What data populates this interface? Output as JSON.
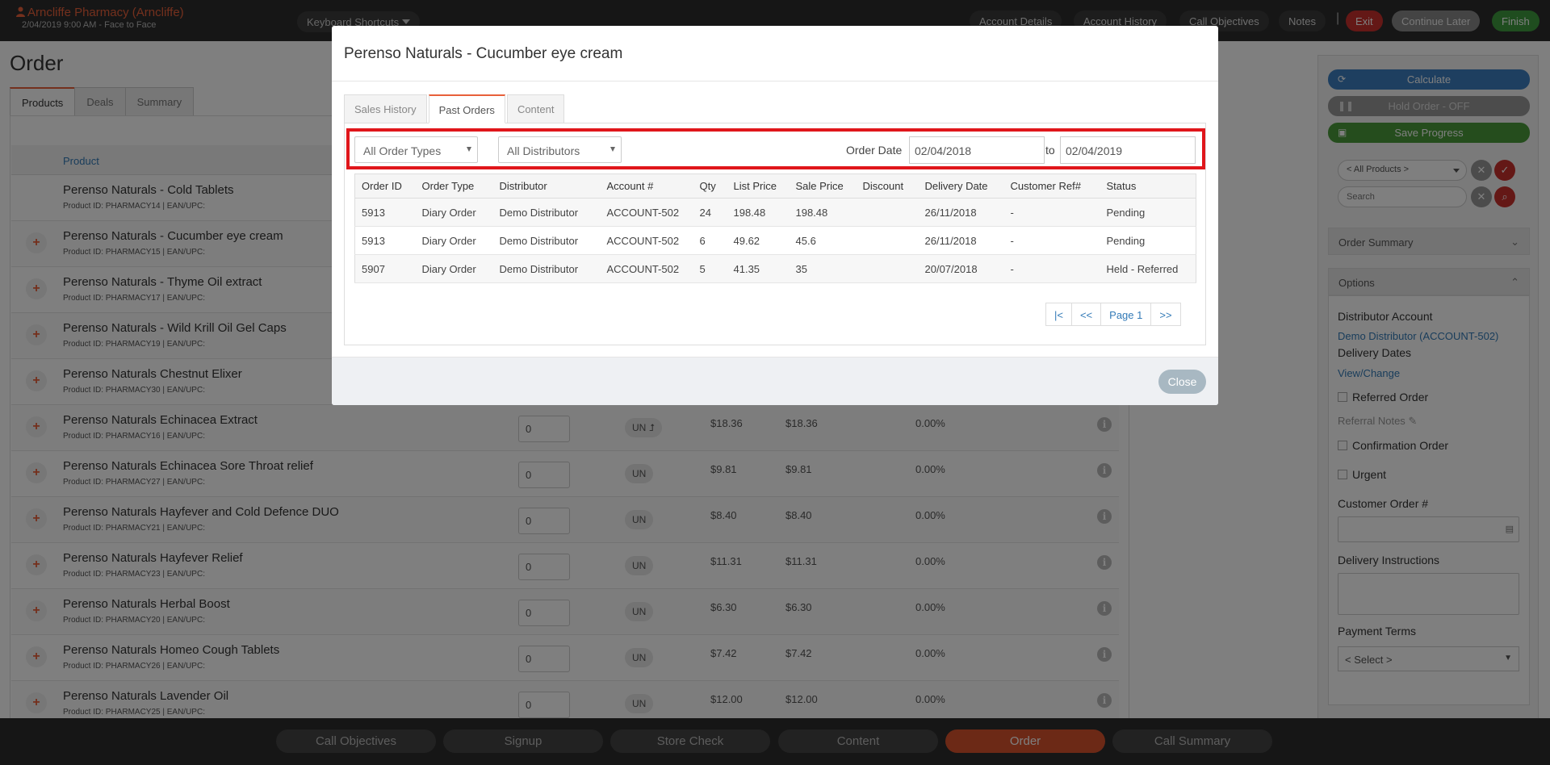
{
  "topbar": {
    "store": "Arncliffe Pharmacy (Arncliffe)",
    "datetime": "2/04/2019 9:00 AM - Face to Face",
    "keyboard_shortcuts": "Keyboard Shortcuts",
    "links": [
      "Account Details",
      "Account History",
      "Call Objectives",
      "Notes"
    ],
    "exit": "Exit",
    "continue_later": "Continue Later",
    "finish": "Finish"
  },
  "page": {
    "title": "Order",
    "tabs": [
      "Products",
      "Deals",
      "Summary"
    ],
    "product_header": "Product"
  },
  "products": [
    {
      "name": "Perenso Naturals - Cold Tablets",
      "id": "Product ID: PHARMACY14 | EAN/UPC:"
    },
    {
      "name": "Perenso Naturals - Cucumber eye cream",
      "id": "Product ID: PHARMACY15 | EAN/UPC:"
    },
    {
      "name": "Perenso Naturals - Thyme Oil extract",
      "id": "Product ID: PHARMACY17 | EAN/UPC:"
    },
    {
      "name": "Perenso Naturals - Wild Krill Oil Gel Caps",
      "id": "Product ID: PHARMACY19 | EAN/UPC:"
    },
    {
      "name": "Perenso Naturals Chestnut Elixer",
      "id": "Product ID: PHARMACY30 | EAN/UPC:"
    },
    {
      "name": "Perenso Naturals Echinacea Extract",
      "id": "Product ID: PHARMACY16 | EAN/UPC:",
      "qty": "0",
      "uom": "UN",
      "uom_mark": "⮥",
      "list": "$18.36",
      "sale": "$18.36",
      "disc": "0.00%"
    },
    {
      "name": "Perenso Naturals Echinacea Sore Throat relief",
      "id": "Product ID: PHARMACY27 | EAN/UPC:",
      "qty": "0",
      "uom": "UN",
      "list": "$9.81",
      "sale": "$9.81",
      "disc": "0.00%"
    },
    {
      "name": "Perenso Naturals Hayfever and Cold Defence DUO",
      "id": "Product ID: PHARMACY21 | EAN/UPC:",
      "qty": "0",
      "uom": "UN",
      "list": "$8.40",
      "sale": "$8.40",
      "disc": "0.00%"
    },
    {
      "name": "Perenso Naturals Hayfever Relief",
      "id": "Product ID: PHARMACY23 | EAN/UPC:",
      "qty": "0",
      "uom": "UN",
      "list": "$11.31",
      "sale": "$11.31",
      "disc": "0.00%"
    },
    {
      "name": "Perenso Naturals Herbal Boost",
      "id": "Product ID: PHARMACY20 | EAN/UPC:",
      "qty": "0",
      "uom": "UN",
      "list": "$6.30",
      "sale": "$6.30",
      "disc": "0.00%"
    },
    {
      "name": "Perenso Naturals Homeo Cough Tablets",
      "id": "Product ID: PHARMACY26 | EAN/UPC:",
      "qty": "0",
      "uom": "UN",
      "list": "$7.42",
      "sale": "$7.42",
      "disc": "0.00%"
    },
    {
      "name": "Perenso Naturals Lavender Oil",
      "id": "Product ID: PHARMACY25 | EAN/UPC:",
      "qty": "0",
      "uom": "UN",
      "list": "$12.00",
      "sale": "$12.00",
      "disc": "0.00%"
    }
  ],
  "right_panel": {
    "calculate": "Calculate",
    "hold_order": "Hold Order - OFF",
    "save_progress": "Save Progress",
    "product_filter": "< All Products >",
    "search_placeholder": "Search",
    "order_summary": "Order Summary",
    "options": "Options",
    "distributor_account_label": "Distributor Account",
    "distributor_account_value": "Demo Distributor (ACCOUNT-502)",
    "delivery_dates_label": "Delivery Dates",
    "view_change": "View/Change",
    "referred_order": "Referred Order",
    "referral_notes": "Referral Notes",
    "confirmation_order": "Confirmation Order",
    "urgent": "Urgent",
    "customer_order_label": "Customer Order #",
    "delivery_instructions_label": "Delivery Instructions",
    "payment_terms_label": "Payment Terms",
    "payment_terms_value": "< Select >"
  },
  "bottom_nav": [
    "Call Objectives",
    "Signup",
    "Store Check",
    "Content",
    "Order",
    "Call Summary"
  ],
  "modal": {
    "title": "Perenso Naturals - Cucumber eye cream",
    "tabs": [
      "Sales History",
      "Past Orders",
      "Content"
    ],
    "order_type_filter": "All Order Types",
    "distributor_filter": "All Distributors",
    "order_date_label": "Order Date",
    "date_from": "02/04/2018",
    "to_label": "to",
    "date_to": "02/04/2019",
    "columns": [
      "Order ID",
      "Order Type",
      "Distributor",
      "Account #",
      "Qty",
      "List Price",
      "Sale Price",
      "Discount",
      "Delivery Date",
      "Customer Ref#",
      "Status"
    ],
    "rows": [
      [
        "5913",
        "Diary Order",
        "Demo Distributor",
        "ACCOUNT-502",
        "24",
        "198.48",
        "198.48",
        "",
        "26/11/2018",
        "-",
        "Pending"
      ],
      [
        "5913",
        "Diary Order",
        "Demo Distributor",
        "ACCOUNT-502",
        "6",
        "49.62",
        "45.6",
        "",
        "26/11/2018",
        "-",
        "Pending"
      ],
      [
        "5907",
        "Diary Order",
        "Demo Distributor",
        "ACCOUNT-502",
        "5",
        "41.35",
        "35",
        "",
        "20/07/2018",
        "-",
        "Held - Referred"
      ]
    ],
    "pager": [
      "|<",
      "<<",
      "Page 1",
      ">>"
    ],
    "close": "Close"
  }
}
